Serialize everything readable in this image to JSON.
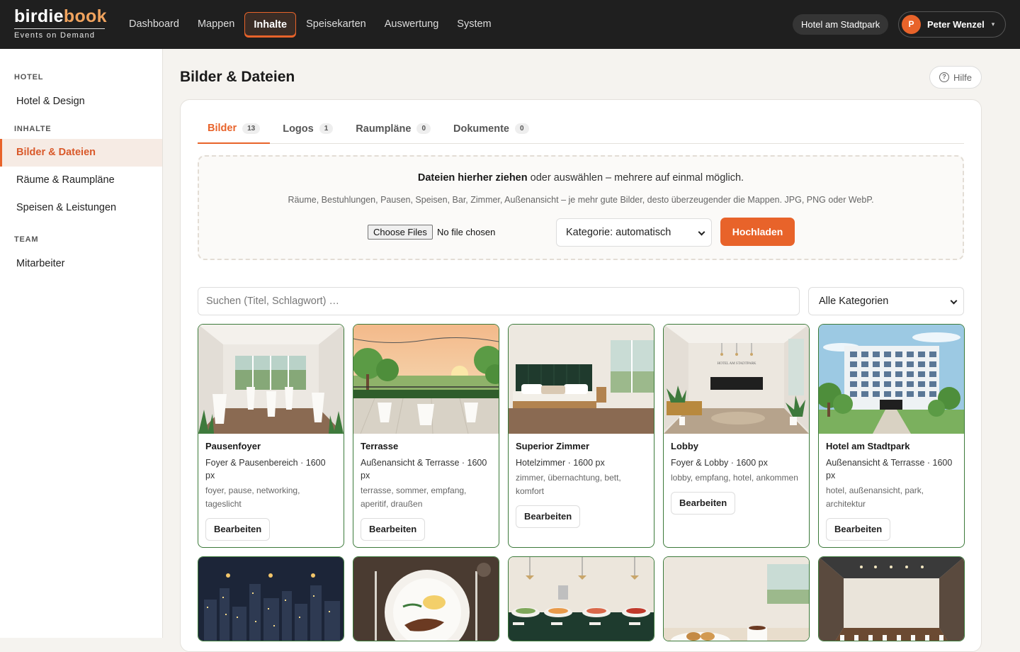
{
  "brand": {
    "name_main": "birdie",
    "name_accent": "book",
    "tagline": "Events on Demand"
  },
  "nav": [
    {
      "label": "Dashboard"
    },
    {
      "label": "Mappen"
    },
    {
      "label": "Inhalte"
    },
    {
      "label": "Speisekarten"
    },
    {
      "label": "Auswertung"
    },
    {
      "label": "System"
    }
  ],
  "header": {
    "hotel": "Hotel am Stadtpark",
    "user_initial": "P",
    "user_name": "Peter Wenzel",
    "caret": "▾"
  },
  "sidebar": {
    "sections": [
      {
        "title": "HOTEL",
        "items": [
          "Hotel & Design"
        ]
      },
      {
        "title": "INHALTE",
        "items": [
          "Bilder & Dateien",
          "Räume & Raumpläne",
          "Speisen & Leistungen"
        ]
      },
      {
        "title": "TEAM",
        "items": [
          "Mitarbeiter"
        ]
      }
    ]
  },
  "page": {
    "title": "Bilder & Dateien",
    "help": "Hilfe",
    "help_icon": "?"
  },
  "tabs": [
    {
      "label": "Bilder",
      "count": "13"
    },
    {
      "label": "Logos",
      "count": "1"
    },
    {
      "label": "Raumpläne",
      "count": "0"
    },
    {
      "label": "Dokumente",
      "count": "0"
    }
  ],
  "upload": {
    "main_bold": "Dateien hierher ziehen",
    "main_rest": " oder auswählen – mehrere auf einmal möglich.",
    "hint": "Räume, Bestuhlungen, Pausen, Speisen, Bar, Zimmer, Außenansicht – je mehr gute Bilder, desto überzeugender die Mappen. JPG, PNG oder WebP.",
    "file_button": "Choose Files",
    "file_status": "No file chosen",
    "category": "Kategorie: automatisch",
    "submit": "Hochladen"
  },
  "filters": {
    "search_placeholder": "Suchen (Titel, Schlagwort) …",
    "category": "Alle Kategorien"
  },
  "cards": [
    {
      "title": "Pausenfoyer",
      "meta": "Foyer & Pausenbereich · 1600 px",
      "tags": "foyer, pause, networking, tageslicht",
      "edit": "Bearbeiten"
    },
    {
      "title": "Terrasse",
      "meta": "Außenansicht & Terrasse · 1600 px",
      "tags": "terrasse, sommer, empfang, aperitif, draußen",
      "edit": "Bearbeiten"
    },
    {
      "title": "Superior Zimmer",
      "meta": "Hotelzimmer · 1600 px",
      "tags": "zimmer, übernachtung, bett, komfort",
      "edit": "Bearbeiten"
    },
    {
      "title": "Lobby",
      "meta": "Foyer & Lobby · 1600 px",
      "tags": "lobby, empfang, hotel, ankommen",
      "edit": "Bearbeiten",
      "sign": "HOTEL AM STADTPARK"
    },
    {
      "title": "Hotel am Stadtpark",
      "meta": "Außenansicht & Terrasse · 1600 px",
      "tags": "hotel, außenansicht, park, architektur",
      "edit": "Bearbeiten"
    }
  ],
  "colors": {
    "accent": "#e8632a",
    "topbar": "#1f1f1f",
    "card_border": "#3c7a3a"
  }
}
